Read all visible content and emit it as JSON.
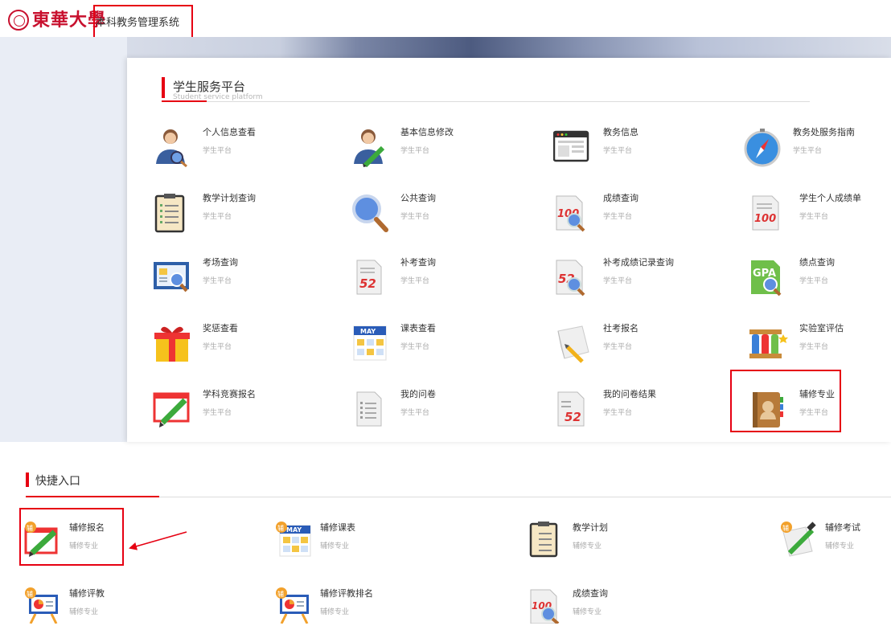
{
  "header": {
    "logo_text": "東華大學",
    "system_title": "本科教务管理系统"
  },
  "student_platform": {
    "title": "学生服务平台",
    "subtitle": "Student service platform",
    "items": [
      {
        "title": "个人信息查看",
        "subtitle": "学生平台",
        "icon": "user-search-icon"
      },
      {
        "title": "基本信息修改",
        "subtitle": "学生平台",
        "icon": "user-edit-icon"
      },
      {
        "title": "教务信息",
        "subtitle": "学生平台",
        "icon": "browser-window-icon"
      },
      {
        "title": "教务处服务指南",
        "subtitle": "学生平台",
        "icon": "compass-icon"
      },
      {
        "title": "教学计划查询",
        "subtitle": "学生平台",
        "icon": "clipboard-checklist-icon"
      },
      {
        "title": "公共查询",
        "subtitle": "学生平台",
        "icon": "magnifier-icon"
      },
      {
        "title": "成绩查询",
        "subtitle": "学生平台",
        "icon": "score-search-icon"
      },
      {
        "title": "学生个人成绩单",
        "subtitle": "学生平台",
        "icon": "score-sheet-icon"
      },
      {
        "title": "考场查询",
        "subtitle": "学生平台",
        "icon": "exam-room-icon"
      },
      {
        "title": "补考查询",
        "subtitle": "学生平台",
        "icon": "makeup-exam-icon"
      },
      {
        "title": "补考成绩记录查询",
        "subtitle": "学生平台",
        "icon": "makeup-score-search-icon"
      },
      {
        "title": "绩点查询",
        "subtitle": "学生平台",
        "icon": "gpa-search-icon"
      },
      {
        "title": "奖惩查看",
        "subtitle": "学生平台",
        "icon": "gift-box-icon"
      },
      {
        "title": "课表查看",
        "subtitle": "学生平台",
        "icon": "calendar-icon"
      },
      {
        "title": "社考报名",
        "subtitle": "学生平台",
        "icon": "paper-pen-icon"
      },
      {
        "title": "实验室评估",
        "subtitle": "学生平台",
        "icon": "test-tubes-icon"
      },
      {
        "title": "学科竞赛报名",
        "subtitle": "学生平台",
        "icon": "window-pencil-icon"
      },
      {
        "title": "我的问卷",
        "subtitle": "学生平台",
        "icon": "questionnaire-icon"
      },
      {
        "title": "我的问卷结果",
        "subtitle": "学生平台",
        "icon": "questionnaire-result-icon"
      },
      {
        "title": "辅修专业",
        "subtitle": "学生平台",
        "icon": "contact-book-icon"
      }
    ]
  },
  "quick_entry": {
    "title": "快捷入口",
    "badge": "辅",
    "items": [
      {
        "title": "辅修报名",
        "subtitle": "辅修专业",
        "icon": "minor-register-icon"
      },
      {
        "title": "辅修课表",
        "subtitle": "辅修专业",
        "icon": "minor-timetable-icon"
      },
      {
        "title": "教学计划",
        "subtitle": "辅修专业",
        "icon": "teaching-plan-icon"
      },
      {
        "title": "辅修考试",
        "subtitle": "辅修专业",
        "icon": "minor-exam-icon"
      },
      {
        "title": "辅修评教",
        "subtitle": "辅修专业",
        "icon": "minor-evaluation-icon"
      },
      {
        "title": "辅修评教排名",
        "subtitle": "辅修专业",
        "icon": "evaluation-ranking-icon"
      },
      {
        "title": "成绩查询",
        "subtitle": "辅修专业",
        "icon": "minor-score-search-icon"
      }
    ]
  },
  "calendar_icon_label": "MAY",
  "gpa_icon_label": "GPA",
  "score_icon_label": "100",
  "makeup_icon_label": "52",
  "colors": {
    "brand_red": "#c8102e",
    "highlight_red": "#e60012",
    "accent_blue": "#3a6fd8"
  }
}
